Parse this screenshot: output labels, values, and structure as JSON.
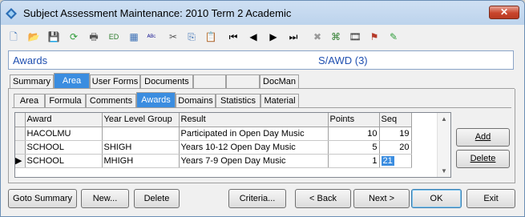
{
  "window": {
    "title": "Subject Assessment Maintenance:  2010 Term 2 Academic",
    "close_label": "✕"
  },
  "toolbar": {
    "icons": [
      "new-icon",
      "open-icon",
      "save-icon",
      "refresh-icon",
      "print-icon",
      "edi-icon",
      "calculator-icon",
      "spellcheck-icon",
      "cut-icon",
      "copy-icon",
      "paste-icon",
      "first-record-icon",
      "previous-record-icon",
      "next-record-icon",
      "last-record-icon",
      "delete-icon",
      "tree-icon",
      "film-icon",
      "flag-icon",
      "edit-add-icon"
    ],
    "glyphs": [
      "🗋",
      "📂",
      "💾",
      "⟳",
      "🖶",
      "ED",
      "▦",
      "ᴬᴮᶜ",
      "✂",
      "⎘",
      "📋",
      "⏮",
      "◀",
      "▶",
      "⏭",
      "✖",
      "⌘",
      "🎞",
      "⚑",
      "✎"
    ]
  },
  "header": {
    "left_text": "Awards",
    "right_text": "S/AWD (3)"
  },
  "top_tabs": [
    {
      "label": "Summary",
      "active": false
    },
    {
      "label": "Area",
      "active": true
    },
    {
      "label": "User Forms",
      "active": false
    },
    {
      "label": "Documents",
      "active": false
    },
    {
      "label": "",
      "active": false
    },
    {
      "label": "",
      "active": false
    },
    {
      "label": "DocMan",
      "active": false
    }
  ],
  "sub_tabs": [
    {
      "label": "Area",
      "active": false
    },
    {
      "label": "Formula",
      "active": false
    },
    {
      "label": "Comments",
      "active": false
    },
    {
      "label": "Awards",
      "active": true
    },
    {
      "label": "Domains",
      "active": false
    },
    {
      "label": "Statistics",
      "active": false
    },
    {
      "label": "Material",
      "active": false
    }
  ],
  "grid": {
    "columns": [
      "Award",
      "Year Level Group",
      "Result",
      "Points",
      "Seq"
    ],
    "rows": [
      [
        "HACOLMU",
        "",
        "Participated in Open Day Music",
        "10",
        "19"
      ],
      [
        "SCHOOL",
        "SHIGH",
        "Years 10-12 Open Day Music",
        "5",
        "20"
      ],
      [
        "SCHOOL",
        "MHIGH",
        "Years 7-9 Open Day Music",
        "1",
        "21"
      ]
    ],
    "current_row_indicator": "▶"
  },
  "side_buttons": {
    "add": "Add",
    "delete": "Delete"
  },
  "bottom_buttons": {
    "goto_summary": "Goto Summary",
    "new": "New...",
    "delete": "Delete",
    "criteria": "Criteria...",
    "back": "< Back",
    "next": "Next >",
    "ok": "OK",
    "exit": "Exit"
  },
  "colors": {
    "accent": "#3b8de0",
    "header_text": "#1f4fb0"
  }
}
